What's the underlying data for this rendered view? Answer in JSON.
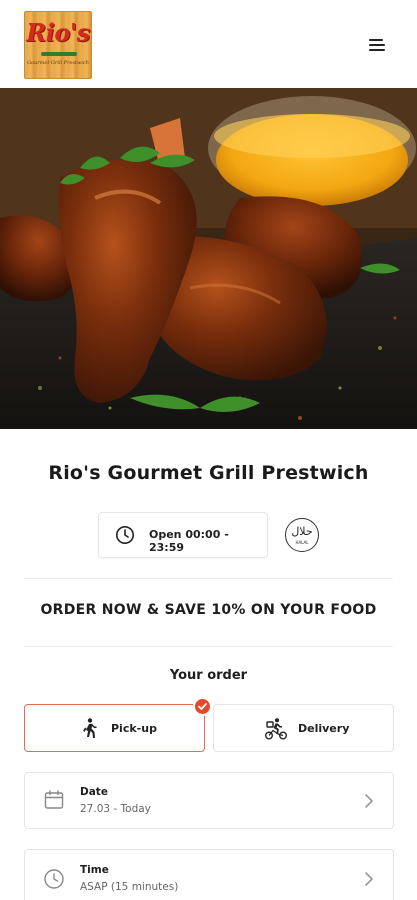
{
  "header": {
    "logo_text": "Rio's",
    "logo_tagline": "Gourmet Grill Prestwich",
    "menu_icon": "hamburger-menu-icon"
  },
  "hero": {
    "image_subject": "glazed chicken wings with dipping sauce"
  },
  "restaurant": {
    "name": "Rio's Gourmet Grill Prestwich",
    "hours": "Open 00:00 - 23:59",
    "halal_badge_ar": "حلال",
    "halal_badge_en": "HALAL"
  },
  "promo": {
    "text": "ORDER NOW & SAVE 10% ON YOUR FOOD"
  },
  "order": {
    "heading": "Your order",
    "modes": [
      {
        "label": "Pick-up",
        "icon": "walking-person-icon",
        "selected": true
      },
      {
        "label": "Delivery",
        "icon": "bicycle-courier-icon",
        "selected": false
      }
    ],
    "date": {
      "label": "Date",
      "value": "27.03 - Today",
      "icon": "calendar-icon"
    },
    "time": {
      "label": "Time",
      "value": "ASAP (15 minutes)",
      "icon": "clock-icon"
    }
  },
  "colors": {
    "accent": "#e6482e",
    "selected_border": "#e66a52",
    "text": "#1a1a1a",
    "muted_text": "#666666",
    "border": "#e4e4e4"
  }
}
